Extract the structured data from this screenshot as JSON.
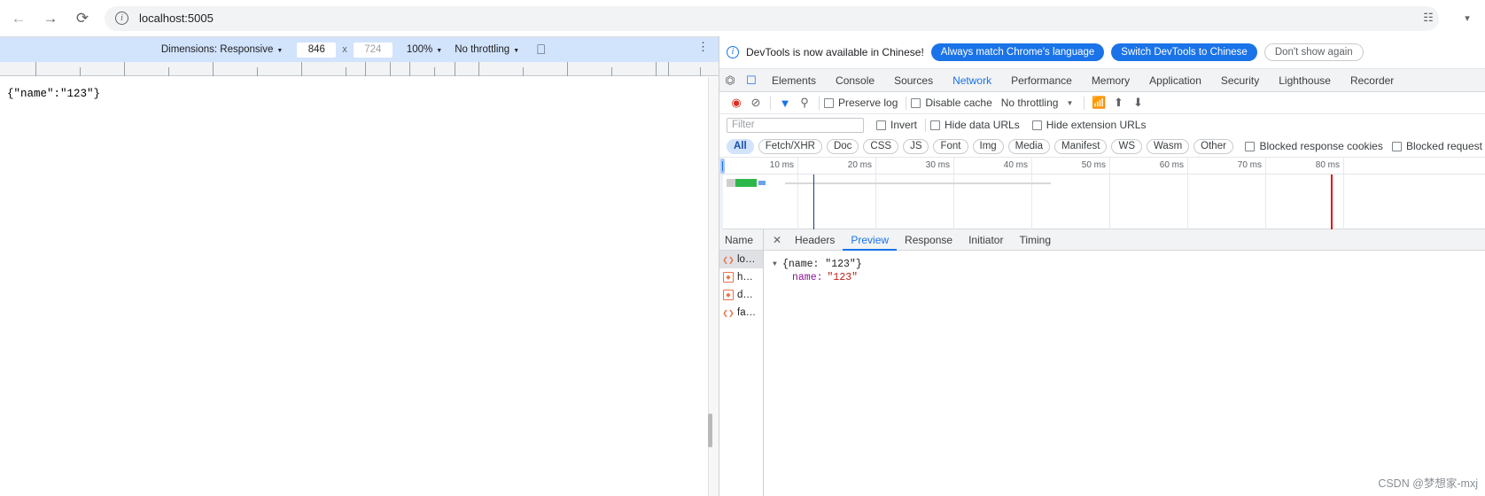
{
  "browser": {
    "back_icon": "arrow-left-icon",
    "forward_icon": "arrow-right-icon",
    "reload_icon": "reload-icon",
    "site_info_icon": "info-icon",
    "url": "localhost:5005",
    "translate_icon": "translate-icon",
    "profile_icon": "profile-icon"
  },
  "device_toolbar": {
    "dimensions_label": "Dimensions: Responsive",
    "width_value": "846",
    "times": "x",
    "height_value": "724",
    "zoom_label": "100%",
    "throttling_label": "No throttling",
    "rotate_icon": "rotate-icon",
    "kebab_icon": "more-options-icon"
  },
  "page": {
    "body_text": "{\"name\":\"123\"}"
  },
  "notice": {
    "icon": "info-icon",
    "message": "DevTools is now available in Chinese!",
    "btn_always_match": "Always match Chrome's language",
    "btn_switch": "Switch DevTools to Chinese",
    "btn_dont_show": "Don't show again"
  },
  "devtools_tabs": {
    "inspect_icon": "inspect-element-icon",
    "device_icon": "device-toolbar-icon",
    "items": [
      {
        "label": "Elements",
        "active": false
      },
      {
        "label": "Console",
        "active": false
      },
      {
        "label": "Sources",
        "active": false
      },
      {
        "label": "Network",
        "active": true
      },
      {
        "label": "Performance",
        "active": false
      },
      {
        "label": "Memory",
        "active": false
      },
      {
        "label": "Application",
        "active": false
      },
      {
        "label": "Security",
        "active": false
      },
      {
        "label": "Lighthouse",
        "active": false
      },
      {
        "label": "Recorder",
        "active": false
      }
    ]
  },
  "network_toolbar": {
    "record_icon": "record-stop-icon",
    "clear_icon": "clear-icon",
    "filter_icon": "filter-icon",
    "search_icon": "search-icon",
    "preserve_log_label": "Preserve log",
    "disable_cache_label": "Disable cache",
    "throttling_value": "No throttling",
    "wifi_icon": "network-conditions-icon",
    "import_icon": "import-har-icon",
    "export_icon": "export-har-icon"
  },
  "filter_row": {
    "filter_placeholder": "Filter",
    "invert_label": "Invert",
    "hide_data_urls_label": "Hide data URLs",
    "hide_extension_urls_label": "Hide extension URLs"
  },
  "type_chips": {
    "items": [
      {
        "label": "All",
        "selected": true
      },
      {
        "label": "Fetch/XHR",
        "selected": false
      },
      {
        "label": "Doc",
        "selected": false
      },
      {
        "label": "CSS",
        "selected": false
      },
      {
        "label": "JS",
        "selected": false
      },
      {
        "label": "Font",
        "selected": false
      },
      {
        "label": "Img",
        "selected": false
      },
      {
        "label": "Media",
        "selected": false
      },
      {
        "label": "Manifest",
        "selected": false
      },
      {
        "label": "WS",
        "selected": false
      },
      {
        "label": "Wasm",
        "selected": false
      },
      {
        "label": "Other",
        "selected": false
      }
    ],
    "blocked_response_cookies_label": "Blocked response cookies",
    "blocked_requests_label": "Blocked request"
  },
  "overview": {
    "ticks": [
      "10 ms",
      "20 ms",
      "30 ms",
      "40 ms",
      "50 ms",
      "60 ms",
      "70 ms",
      "80 ms"
    ]
  },
  "request_list": {
    "column_header": "Name",
    "rows": [
      {
        "icon": "json-doc-icon",
        "name": "lo…",
        "selected": true
      },
      {
        "icon": "xhr-icon",
        "name": "h…",
        "selected": false
      },
      {
        "icon": "xhr-icon",
        "name": "d…",
        "selected": false
      },
      {
        "icon": "json-doc-icon",
        "name": "fa…",
        "selected": false
      }
    ]
  },
  "detail": {
    "close_icon": "close-icon",
    "tabs": [
      {
        "label": "Headers",
        "active": false
      },
      {
        "label": "Preview",
        "active": true
      },
      {
        "label": "Response",
        "active": false
      },
      {
        "label": "Initiator",
        "active": false
      },
      {
        "label": "Timing",
        "active": false
      }
    ],
    "preview": {
      "triangle": "▼",
      "root_line": "{name: \"123\"}",
      "key": "name:",
      "value": "\"123\""
    }
  },
  "watermark": {
    "text": "CSDN @梦想家-mxj"
  },
  "colors": {
    "accent": "#1a73e8",
    "record": "#d93025",
    "device_bar": "#d2e3fc",
    "chip_selected": "#d2e3fc",
    "waterfall_green": "#2eb84b"
  }
}
